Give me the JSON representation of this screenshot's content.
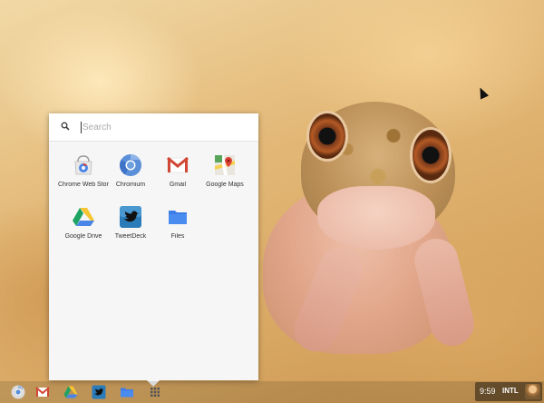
{
  "launcher": {
    "search": {
      "placeholder": "Search",
      "value": ""
    },
    "apps": [
      {
        "label": "Chrome Web Store",
        "icon": "chrome-web-store-icon"
      },
      {
        "label": "Chromium",
        "icon": "chromium-icon"
      },
      {
        "label": "Gmail",
        "icon": "gmail-icon"
      },
      {
        "label": "Google Maps",
        "icon": "google-maps-icon"
      },
      {
        "label": "Google Drive",
        "icon": "google-drive-icon"
      },
      {
        "label": "TweetDeck",
        "icon": "tweetdeck-icon"
      },
      {
        "label": "Files",
        "icon": "files-icon"
      }
    ]
  },
  "shelf": {
    "items": [
      {
        "icon": "chrome-icon"
      },
      {
        "icon": "gmail-icon"
      },
      {
        "icon": "google-drive-icon"
      },
      {
        "icon": "tweetdeck-icon"
      },
      {
        "icon": "files-icon"
      },
      {
        "icon": "app-launcher-icon"
      }
    ],
    "status": {
      "time": "9:59",
      "input_method": "INTL"
    }
  },
  "colors": {
    "launcher_bg": "#f6f6f6",
    "files_blue": "#3d7de6",
    "tweetdeck_blue": "#2b7bb9",
    "gmail_red": "#d14836"
  }
}
